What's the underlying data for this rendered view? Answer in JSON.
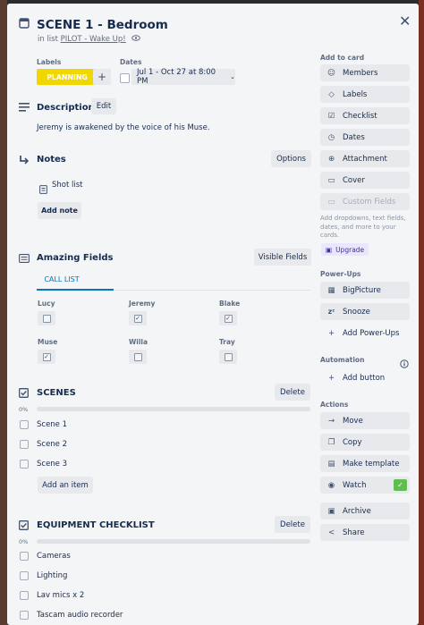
{
  "card": {
    "title": "SCENE 1 - Bedroom",
    "in_list_prefix": "in list",
    "list_name": "PILOT - Wake Up!"
  },
  "labels": {
    "heading": "Labels",
    "items": [
      {
        "text": "PLANNING",
        "color": "#f2d600"
      }
    ],
    "add": "+"
  },
  "dates": {
    "heading": "Dates",
    "value": "Jul 1 - Oct 27 at 8:00 PM"
  },
  "description": {
    "heading": "Description",
    "edit_label": "Edit",
    "text": "Jeremy is awakened by the voice of his Muse."
  },
  "notes": {
    "heading": "Notes",
    "options_label": "Options",
    "items": [
      "Shot list"
    ],
    "add_label": "Add note"
  },
  "amazing_fields": {
    "heading": "Amazing Fields",
    "visible_label": "Visible Fields",
    "tab": "CALL LIST",
    "fields": [
      {
        "name": "Lucy",
        "checked": false
      },
      {
        "name": "Jeremy",
        "checked": true
      },
      {
        "name": "Blake",
        "checked": true
      },
      {
        "name": "Muse",
        "checked": true
      },
      {
        "name": "Willa",
        "checked": false
      },
      {
        "name": "Tray",
        "checked": false
      }
    ]
  },
  "scenes": {
    "heading": "SCENES",
    "delete_label": "Delete",
    "percent": "0%",
    "progress": 0,
    "items": [
      "Scene 1",
      "Scene 2",
      "Scene 3"
    ],
    "add_label": "Add an item"
  },
  "equipment": {
    "heading": "EQUIPMENT CHECKLIST",
    "delete_label": "Delete",
    "percent": "0%",
    "progress": 0,
    "items": [
      "Cameras",
      "Lighting",
      "Lav mics x 2",
      "Tascam audio recorder"
    ]
  },
  "sidebar": {
    "add_to_card": "Add to card",
    "add_items": [
      {
        "label": "Members",
        "icon": "person-icon"
      },
      {
        "label": "Labels",
        "icon": "tag-icon"
      },
      {
        "label": "Checklist",
        "icon": "checklist-icon"
      },
      {
        "label": "Dates",
        "icon": "clock-icon"
      },
      {
        "label": "Attachment",
        "icon": "paperclip-icon"
      },
      {
        "label": "Cover",
        "icon": "cover-icon"
      },
      {
        "label": "Custom Fields",
        "icon": "custom-fields-icon"
      }
    ],
    "custom_fields_hint": "Add dropdowns, text fields, dates, and more to your cards.",
    "upgrade_label": "Upgrade",
    "powerups_heading": "Power-Ups",
    "powerups": [
      {
        "label": "BigPicture",
        "icon": "bigpicture-icon"
      },
      {
        "label": "Snooze",
        "icon": "snooze-icon"
      },
      {
        "label": "Add Power-Ups",
        "icon": "plus-icon"
      }
    ],
    "automation_heading": "Automation",
    "add_button_label": "Add button",
    "actions_heading": "Actions",
    "actions": [
      {
        "label": "Move",
        "icon": "arrow-right-icon"
      },
      {
        "label": "Copy",
        "icon": "copy-icon"
      },
      {
        "label": "Make template",
        "icon": "template-icon"
      },
      {
        "label": "Watch",
        "icon": "eye-icon"
      },
      {
        "label": "Archive",
        "icon": "archive-icon"
      },
      {
        "label": "Share",
        "icon": "share-icon"
      }
    ],
    "watch_checked_color": "#61bd4f"
  }
}
